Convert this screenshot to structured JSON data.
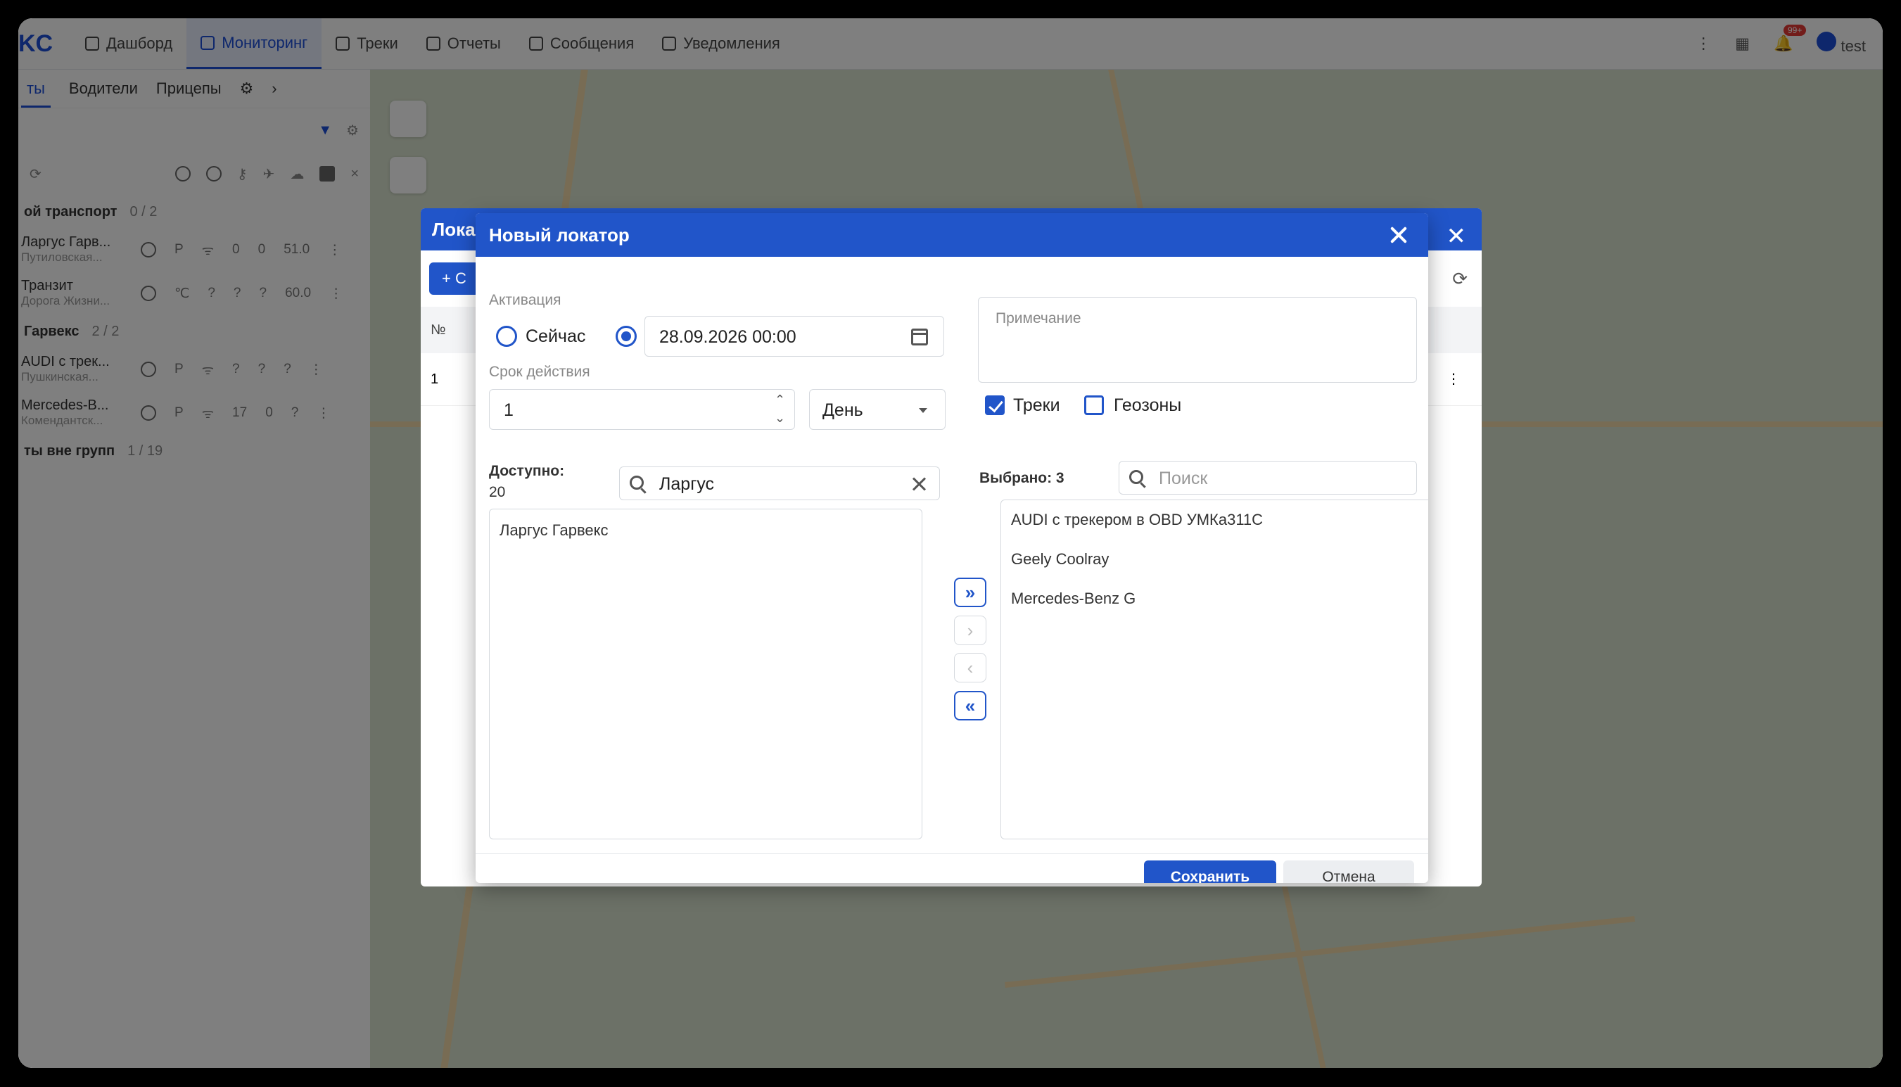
{
  "app": {
    "logo": "KC",
    "nav": [
      {
        "label": "Дашборд",
        "icon": "chart-icon"
      },
      {
        "label": "Мониторинг",
        "icon": "navigation-icon",
        "active": true
      },
      {
        "label": "Треки",
        "icon": "track-icon"
      },
      {
        "label": "Отчеты",
        "icon": "report-icon"
      },
      {
        "label": "Сообщения",
        "icon": "message-icon"
      },
      {
        "label": "Уведомления",
        "icon": "notification-icon"
      }
    ],
    "user": "test",
    "notification_count": "99+"
  },
  "sidebar": {
    "tabs": [
      "ты",
      "Водители",
      "Прицепы"
    ],
    "groups": [
      {
        "name": "ой транспорт",
        "count": "0 / 2",
        "items": [
          {
            "name": "Ларгус Гарв...",
            "sub": "Путиловская...",
            "v1": "0",
            "v2": "0",
            "v3": "51.0"
          },
          {
            "name": "Транзит",
            "sub": "Дорога Жизни...",
            "v1": "?",
            "v2": "?",
            "v3": "60.0"
          }
        ]
      },
      {
        "name": "Гарвекс",
        "count": "2 / 2",
        "items": [
          {
            "name": "AUDI с трек...",
            "sub": "Пушкинская...",
            "v1": "?",
            "v2": "?",
            "v3": "?"
          },
          {
            "name": "Mercedes-B...",
            "sub": "Комендантск...",
            "v1": "17",
            "v2": "0",
            "v3": "?"
          }
        ]
      },
      {
        "name": "ты вне групп",
        "count": "1 / 19",
        "items": []
      }
    ]
  },
  "bg_window": {
    "title": "Лока",
    "add_label": "+ С",
    "col_num": "№",
    "row_num": "1"
  },
  "dialog": {
    "title": "Новый локатор",
    "activation_label": "Активация",
    "now_label": "Сейчас",
    "datetime_value": "28.09.2026 00:00",
    "note_placeholder": "Примечание",
    "duration_label": "Срок действия",
    "duration_value": "1",
    "unit_value": "День",
    "tracks_label": "Треки",
    "tracks_checked": true,
    "geozones_label": "Геозоны",
    "geozones_checked": false,
    "available_label": "Доступно:",
    "available_count": "20",
    "available_search": "Ларгус",
    "available_items": [
      "Ларгус Гарвекс"
    ],
    "selected_label": "Выбрано: 3",
    "selected_search_placeholder": "Поиск",
    "selected_items": [
      "AUDI с трекером в OBD УМКа311С",
      "Geely Coolray",
      "Mercedes-Benz G"
    ],
    "move_all_right": "»",
    "move_right": "›",
    "move_left": "‹",
    "move_all_left": "«",
    "save_label": "Сохранить",
    "cancel_label": "Отмена"
  },
  "colors": {
    "accent": "#2155c9",
    "overlay": "rgba(0,0,0,0.5)"
  }
}
